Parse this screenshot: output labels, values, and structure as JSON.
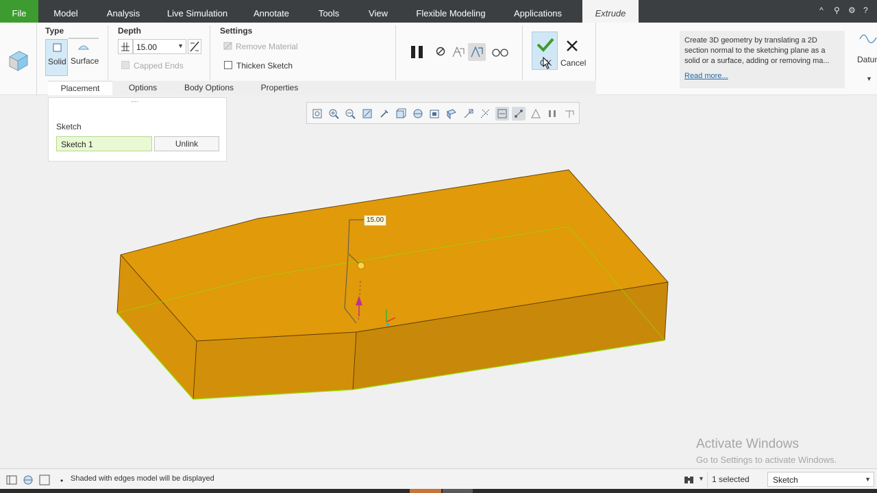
{
  "menu": {
    "items": [
      {
        "label": "File"
      },
      {
        "label": "Model"
      },
      {
        "label": "Analysis"
      },
      {
        "label": "Live Simulation"
      },
      {
        "label": "Annotate"
      },
      {
        "label": "Tools"
      },
      {
        "label": "View"
      },
      {
        "label": "Flexible Modeling"
      },
      {
        "label": "Applications"
      },
      {
        "label": "Extrude"
      }
    ],
    "active_tab": "Extrude",
    "window_controls": {
      "minimize": "^",
      "search": "⚲",
      "settings": "⚙",
      "help": "?"
    }
  },
  "ribbon": {
    "type": {
      "title": "Type",
      "solid_label": "Solid",
      "surface_label": "Surface"
    },
    "depth": {
      "title": "Depth",
      "value": "15.00"
    },
    "settings": {
      "title": "Settings",
      "remove_material": "Remove Material",
      "capped_ends": "Capped Ends",
      "thicken_sketch": "Thicken Sketch"
    },
    "actions": {
      "ok_label": "OK",
      "cancel_label": "Cancel"
    },
    "help": {
      "text": "Create 3D geometry by translating a 2D section normal to the sketching plane as a solid or a surface, adding or removing ma...",
      "link": "Read more..."
    },
    "datum_label": "Datum",
    "sub_tabs": [
      {
        "label": "Placement"
      },
      {
        "label": "Options"
      },
      {
        "label": "Body Options"
      },
      {
        "label": "Properties"
      }
    ],
    "active_sub_tab": "Placement"
  },
  "placement": {
    "section_label": "Sketch",
    "sketch_value": "Sketch 1",
    "unlink_label": "Unlink",
    "handle": "...."
  },
  "graphics_toolbar": {
    "icons": [
      "refit-icon",
      "zoom-in-icon",
      "zoom-out-icon",
      "repaint-icon",
      "pan-icon",
      "display-style-icon",
      "saved-orientations-icon",
      "view-manager-icon",
      "perspective-icon",
      "datum-display-icon",
      "annotation-display-icon",
      "spin-center-icon",
      "sketch-display-icon",
      "shading-icon",
      "pause-icon",
      "view-normal-icon"
    ]
  },
  "viewport": {
    "dimension_label": "15.00",
    "model_color": "#e09a0a",
    "model_side_color": "#c5860a",
    "model_front_color": "#d08f0a",
    "edge_highlight": "#8fe000"
  },
  "status": {
    "message": "Shaded with edges model will be displayed",
    "selected": "1 selected",
    "filter": "Sketch"
  },
  "watermark": {
    "title": "Activate Windows",
    "subtitle": "Go to Settings to activate Windows."
  }
}
